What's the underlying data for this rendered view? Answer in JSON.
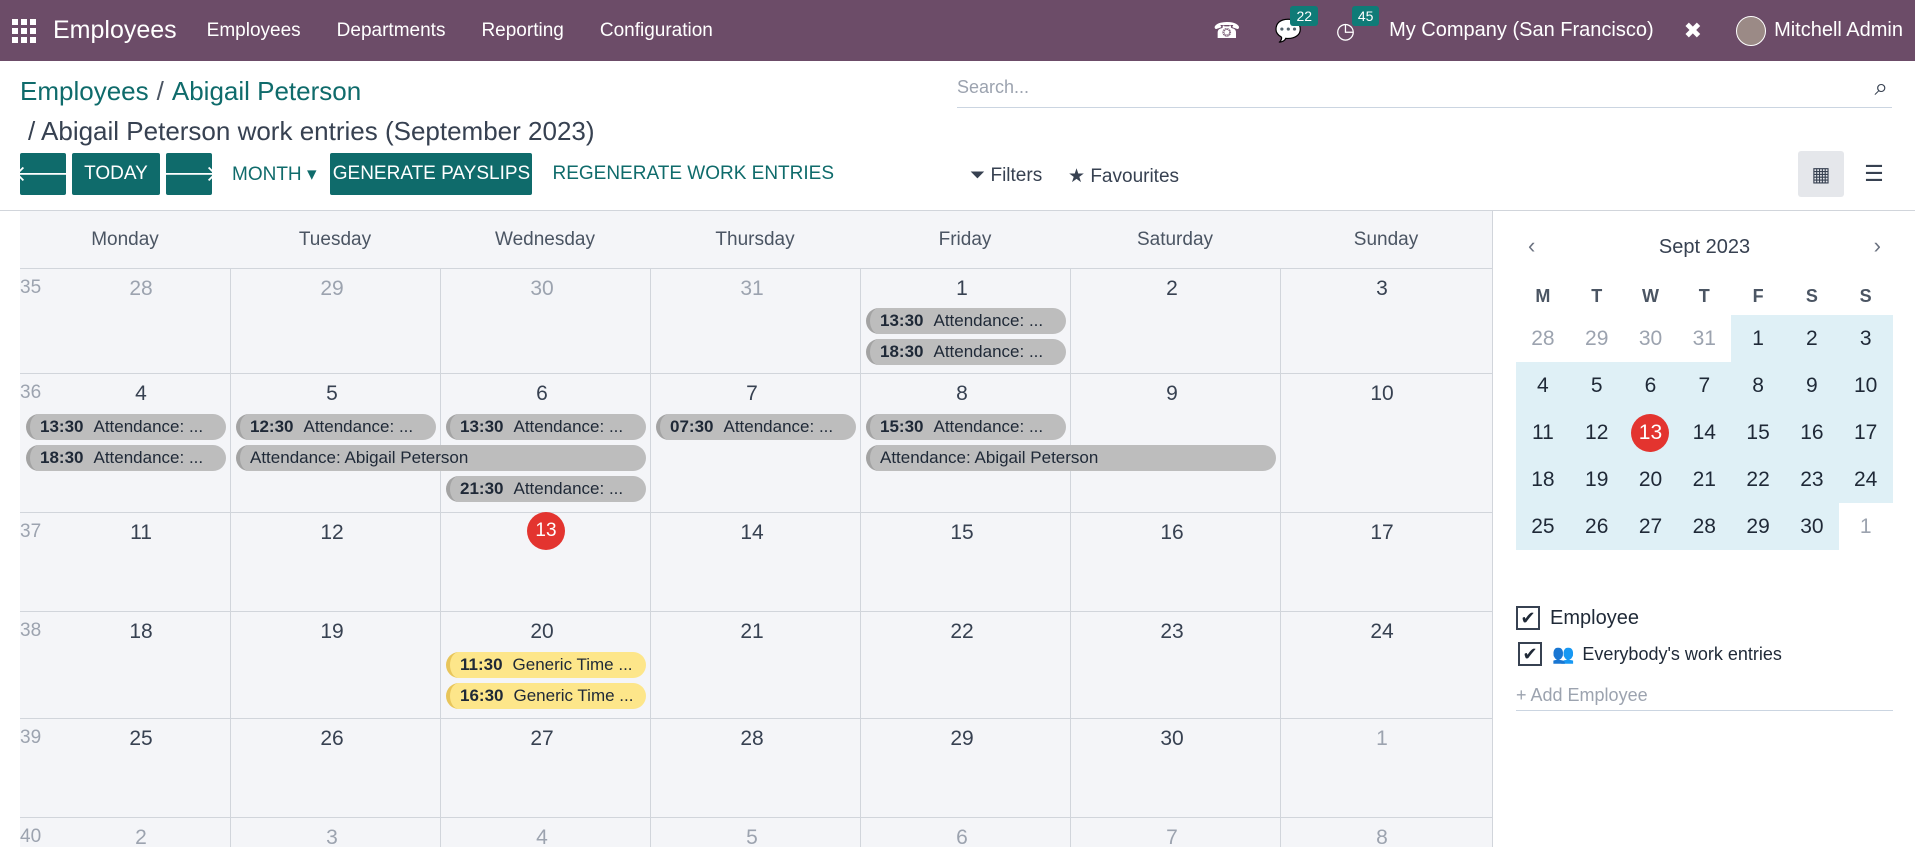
{
  "topbar": {
    "app_name": "Employees",
    "menus": [
      "Employees",
      "Departments",
      "Reporting",
      "Configuration"
    ],
    "chat_badge": "22",
    "activity_badge": "45",
    "company": "My Company (San Francisco)",
    "user": "Mitchell Admin"
  },
  "breadcrumb": {
    "root": "Employees",
    "sep": "/",
    "employee": "Abigail Peterson"
  },
  "subtitle": "/ Abigail Peterson work entries (September 2023)",
  "search": {
    "placeholder": "Search..."
  },
  "toolbar": {
    "prev": "🡐",
    "today": "TODAY",
    "next": "🡒",
    "scale": "MONTH",
    "generate": "GENERATE PAYSLIPS",
    "regenerate": "REGENERATE WORK ENTRIES",
    "filters": "Filters",
    "favourites": "Favourites"
  },
  "calendar": {
    "weekdays": [
      "Monday",
      "Tuesday",
      "Wednesday",
      "Thursday",
      "Friday",
      "Saturday",
      "Sunday"
    ],
    "weeks": [
      {
        "num": "35",
        "days": [
          "28",
          "29",
          "30",
          "31",
          "1",
          "2",
          "3"
        ]
      },
      {
        "num": "36",
        "days": [
          "4",
          "5",
          "6",
          "7",
          "8",
          "9",
          "10"
        ]
      },
      {
        "num": "37",
        "days": [
          "11",
          "12",
          "13",
          "14",
          "15",
          "16",
          "17"
        ]
      },
      {
        "num": "38",
        "days": [
          "18",
          "19",
          "20",
          "21",
          "22",
          "23",
          "24"
        ]
      },
      {
        "num": "39",
        "days": [
          "25",
          "26",
          "27",
          "28",
          "29",
          "30",
          "1"
        ]
      },
      {
        "num": "40",
        "days": [
          "2",
          "3",
          "4",
          "5",
          "6",
          "7",
          "8"
        ]
      }
    ],
    "events": {
      "fri1_a": {
        "time": "13:30",
        "label": "Attendance: ..."
      },
      "fri1_b": {
        "time": "18:30",
        "label": "Attendance: ..."
      },
      "mon4_a": {
        "time": "13:30",
        "label": "Attendance: ..."
      },
      "mon4_b": {
        "time": "18:30",
        "label": "Attendance: ..."
      },
      "tue5_a": {
        "time": "12:30",
        "label": "Attendance: ..."
      },
      "tue5_span": {
        "label": "Attendance: Abigail Peterson"
      },
      "wed6_a": {
        "time": "13:30",
        "label": "Attendance: ..."
      },
      "wed6_c": {
        "time": "21:30",
        "label": "Attendance: ..."
      },
      "thu7_a": {
        "time": "07:30",
        "label": "Attendance: ..."
      },
      "fri8_a": {
        "time": "15:30",
        "label": "Attendance: ..."
      },
      "fri8_span": {
        "label": "Attendance: Abigail Peterson"
      },
      "wed20_a": {
        "time": "11:30",
        "label": "Generic Time ..."
      },
      "wed20_b": {
        "time": "16:30",
        "label": "Generic Time ..."
      }
    }
  },
  "mini_calendar": {
    "title": "Sept 2023",
    "weekdays": [
      "M",
      "T",
      "W",
      "T",
      "F",
      "S",
      "S"
    ],
    "days": [
      "28",
      "29",
      "30",
      "31",
      "1",
      "2",
      "3",
      "4",
      "5",
      "6",
      "7",
      "8",
      "9",
      "10",
      "11",
      "12",
      "13",
      "14",
      "15",
      "16",
      "17",
      "18",
      "19",
      "20",
      "21",
      "22",
      "23",
      "24",
      "25",
      "26",
      "27",
      "28",
      "29",
      "30",
      "1"
    ],
    "today": "13"
  },
  "filters_panel": {
    "employee": "Employee",
    "everybody": "Everybody's work entries",
    "add": "+ Add Employee"
  },
  "colors": {
    "navbar": "#6c4c68",
    "primary": "#0f6b6b",
    "today": "#e3342f",
    "event_gray": "#bdbdbd",
    "event_yellow": "#fde68a"
  }
}
